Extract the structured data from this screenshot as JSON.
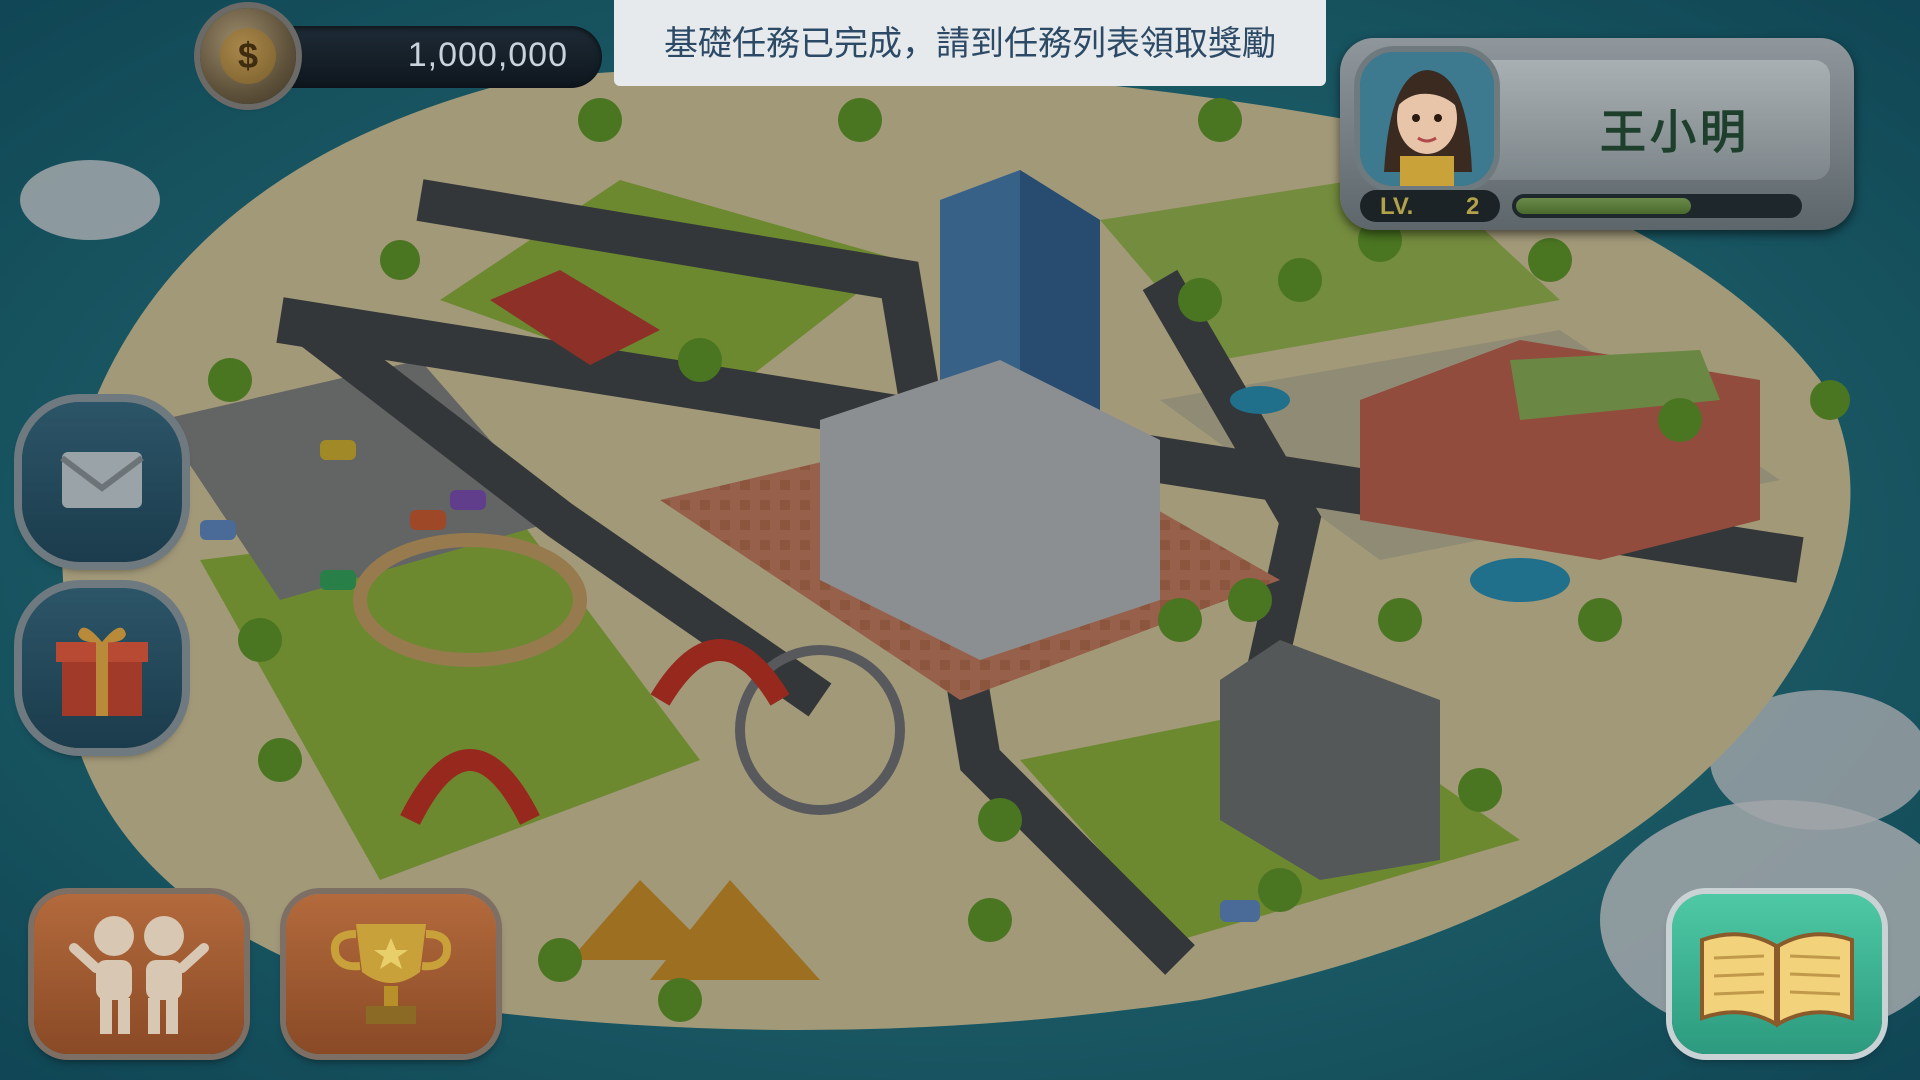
{
  "hud": {
    "coins": "1,000,000"
  },
  "notification": {
    "message": "基礎任務已完成，請到任務列表領取獎勵"
  },
  "profile": {
    "name": "王小明",
    "level_label": "LV.",
    "level_value": "2",
    "xp_progress": 0.62
  },
  "buttons": {
    "mail": "mail-icon",
    "gift": "gift-icon",
    "friends": "friends-icon",
    "trophy": "trophy-icon",
    "quests": "open-book-icon"
  },
  "colors": {
    "sea": "#1e7a8e",
    "sand": "#e8d9a8",
    "grass": "#8dbb3a",
    "road": "#4a4f52",
    "banner_text": "#2c4a66",
    "book_button": "#3cbf98",
    "orange_button": "#b36a3c"
  }
}
